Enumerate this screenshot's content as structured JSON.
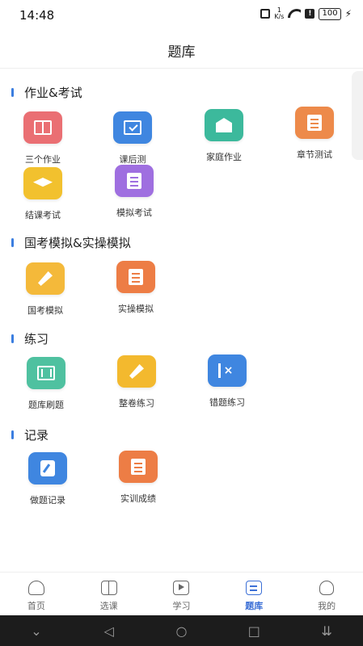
{
  "status": {
    "time": "14:48",
    "speed_value": "1",
    "speed_unit": "K/s",
    "alert": "!",
    "battery": "100",
    "bolt": "⚡"
  },
  "header": {
    "title": "题库"
  },
  "sections": [
    {
      "title": "作业&考试",
      "items": [
        {
          "label": "三个作业",
          "color": "#ea6f73",
          "icon": "book-icon"
        },
        {
          "label": "课后测",
          "color": "#3f86e0",
          "icon": "monitor-check-icon"
        },
        {
          "label": "家庭作业",
          "color": "#3cb99c",
          "icon": "house-icon"
        },
        {
          "label": "章节测试",
          "color": "#ed8a4a",
          "icon": "bookmark-book-icon"
        },
        {
          "label": "结课考试",
          "color": "#f2c12e",
          "icon": "graduation-cap-icon"
        },
        {
          "label": "模拟考试",
          "color": "#9f6fe0",
          "icon": "document-check-icon"
        }
      ]
    },
    {
      "title": "国考模拟&实操模拟",
      "items": [
        {
          "label": "国考模拟",
          "color": "#f4b93a",
          "icon": "pen-icon"
        },
        {
          "label": "实操模拟",
          "color": "#ed7d45",
          "icon": "scroll-icon"
        }
      ]
    },
    {
      "title": "练习",
      "items": [
        {
          "label": "题库刷题",
          "color": "#4fc1a0",
          "icon": "film-list-icon"
        },
        {
          "label": "整卷练习",
          "color": "#f3b92e",
          "icon": "edit-paper-icon"
        },
        {
          "label": "错题练习",
          "color": "#3f86e0",
          "icon": "wrong-mark-icon"
        }
      ]
    },
    {
      "title": "记录",
      "items": [
        {
          "label": "做题记录",
          "color": "#3f86e0",
          "icon": "notebook-icon"
        },
        {
          "label": "实训成绩",
          "color": "#ed7d45",
          "icon": "report-icon"
        }
      ]
    }
  ],
  "nav": [
    {
      "label": "首页",
      "icon": "home-icon",
      "active": false
    },
    {
      "label": "选课",
      "icon": "open-book-icon",
      "active": false
    },
    {
      "label": "学习",
      "icon": "play-screen-icon",
      "active": false
    },
    {
      "label": "题库",
      "icon": "edit-doc-icon",
      "active": true
    },
    {
      "label": "我的",
      "icon": "user-icon",
      "active": false
    }
  ],
  "system_nav": [
    "⌄",
    "◁",
    "○",
    "□",
    "⇊"
  ]
}
